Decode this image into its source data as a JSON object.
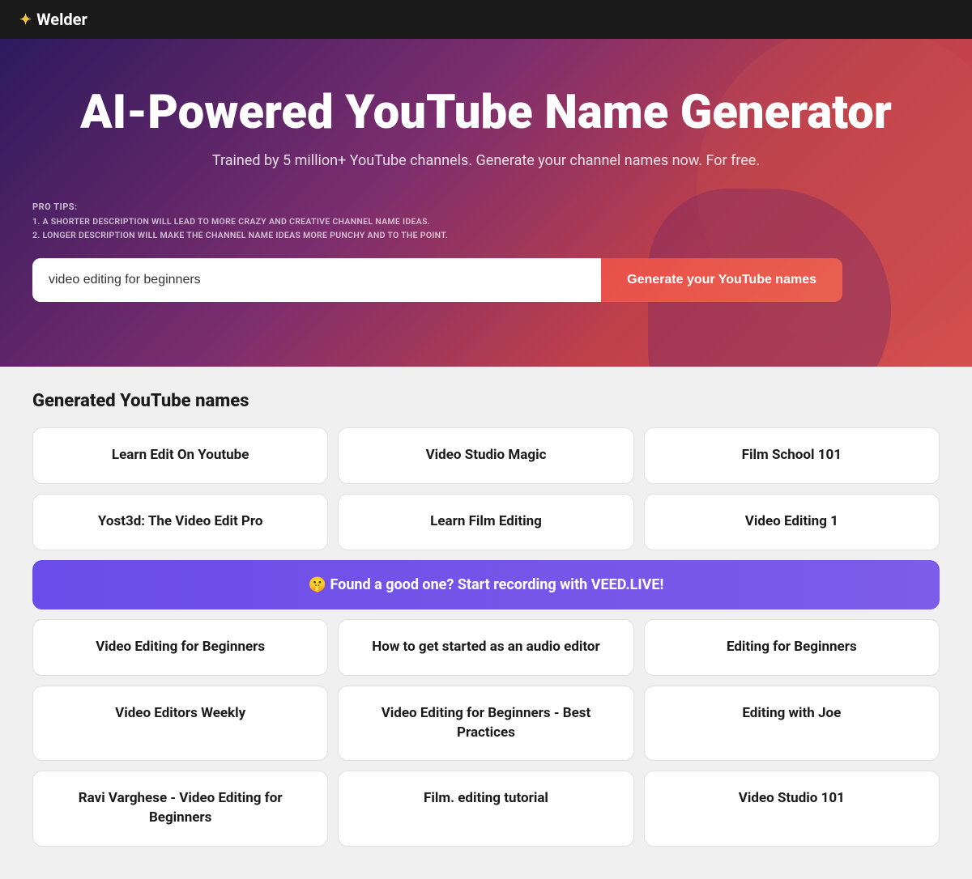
{
  "header": {
    "logo_icon": "✦",
    "logo_text": "Welder"
  },
  "hero": {
    "title": "AI-Powered YouTube Name Generator",
    "subtitle": "Trained by 5 million+ YouTube channels. Generate your channel names now. For free.",
    "pro_tips_label": "PRO TIPS:",
    "pro_tips": [
      "1. A SHORTER DESCRIPTION WILL LEAD TO MORE CRAZY AND CREATIVE CHANNEL NAME IDEAS.",
      "2. LONGER DESCRIPTION WILL MAKE THE CHANNEL NAME IDEAS MORE PUNCHY AND TO THE POINT."
    ],
    "input_value": "video editing for beginners",
    "button_label": "Generate your YouTube names"
  },
  "results": {
    "section_title": "Generated YouTube names",
    "promo_text": "🤫 Found a good one? Start recording with VEED.LIVE!",
    "names": [
      {
        "id": 1,
        "text": "Learn Edit On Youtube"
      },
      {
        "id": 2,
        "text": "Video Studio Magic"
      },
      {
        "id": 3,
        "text": "Film School 101"
      },
      {
        "id": 4,
        "text": "Yost3d: The Video Edit Pro"
      },
      {
        "id": 5,
        "text": "Learn Film Editing"
      },
      {
        "id": 6,
        "text": "Video Editing 1"
      },
      {
        "id": 7,
        "text": "Video Editing for Beginners"
      },
      {
        "id": 8,
        "text": "How to get started as an audio editor"
      },
      {
        "id": 9,
        "text": "Editing for Beginners"
      },
      {
        "id": 10,
        "text": "Video Editors Weekly"
      },
      {
        "id": 11,
        "text": "Video Editing for Beginners - Best Practices"
      },
      {
        "id": 12,
        "text": "Editing with Joe"
      },
      {
        "id": 13,
        "text": "Ravi Varghese - Video Editing for Beginners"
      },
      {
        "id": 14,
        "text": "Film. editing tutorial"
      },
      {
        "id": 15,
        "text": "Video Studio 101"
      }
    ]
  }
}
